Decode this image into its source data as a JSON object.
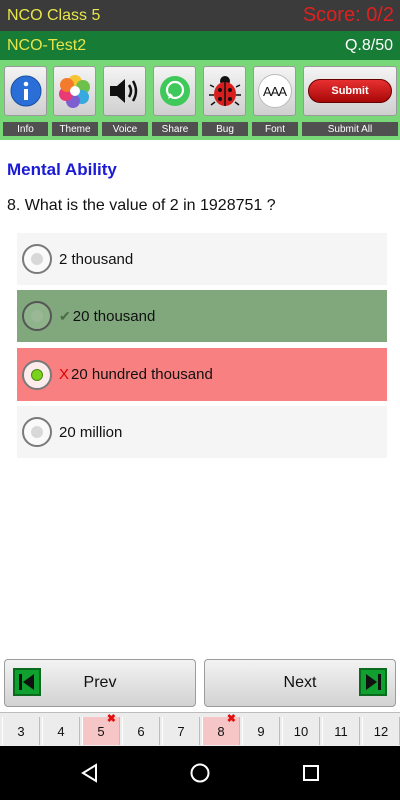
{
  "header": {
    "app_title": "NCO Class 5",
    "score": "Score: 0/2",
    "test_name": "NCO-Test2",
    "question_counter": "Q.8/50"
  },
  "toolbar": {
    "items": [
      {
        "label": "Info",
        "icon": "info-icon"
      },
      {
        "label": "Theme",
        "icon": "theme-icon"
      },
      {
        "label": "Voice",
        "icon": "speaker-icon"
      },
      {
        "label": "Share",
        "icon": "share-icon"
      },
      {
        "label": "Bug",
        "icon": "bug-icon"
      },
      {
        "label": "Font",
        "icon": "font-size-icon"
      },
      {
        "label": "Submit All",
        "icon": "submit-icon"
      }
    ],
    "font_icon_text": "AAA",
    "submit_button_text": "Submit"
  },
  "section_title": "Mental Ability",
  "question": "8. What is the value of 2 in 1928751 ?",
  "options": [
    {
      "text": "2 thousand",
      "state": "neutral",
      "mark": ""
    },
    {
      "text": "20 thousand",
      "state": "correct",
      "mark": "✔"
    },
    {
      "text": "20 hundred thousand",
      "state": "wrong-selected",
      "mark": "X"
    },
    {
      "text": "20 million",
      "state": "neutral",
      "mark": ""
    }
  ],
  "colors": {
    "correct_bg": "#80a87c",
    "wrong_bg": "#f98080",
    "neutral_bg": "#f5f5f5"
  },
  "nav": {
    "prev_label": "Prev",
    "next_label": "Next"
  },
  "question_strip": [
    {
      "num": "3",
      "wrong": false
    },
    {
      "num": "4",
      "wrong": false
    },
    {
      "num": "5",
      "wrong": true
    },
    {
      "num": "6",
      "wrong": false
    },
    {
      "num": "7",
      "wrong": false
    },
    {
      "num": "8",
      "wrong": true
    },
    {
      "num": "9",
      "wrong": false
    },
    {
      "num": "10",
      "wrong": false
    },
    {
      "num": "11",
      "wrong": false
    },
    {
      "num": "12",
      "wrong": false
    }
  ],
  "wrong_marker": "✖"
}
